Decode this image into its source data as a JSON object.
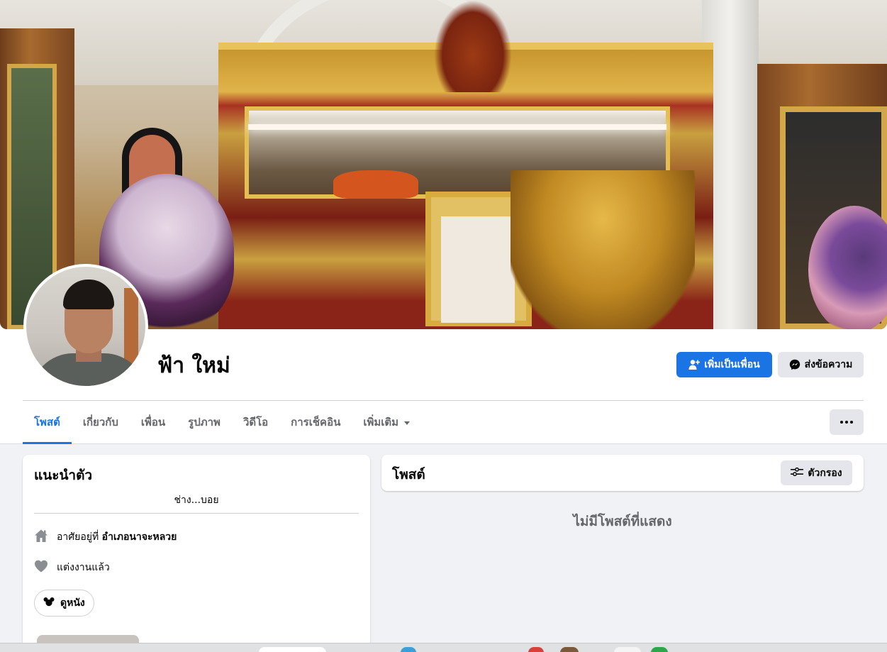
{
  "profile": {
    "name": "ฟ้า ใหม่",
    "add_friend_label": "เพิ่มเป็นเพื่อน",
    "message_label": "ส่งข้อความ"
  },
  "tabs": [
    {
      "label": "โพสต์",
      "active": true
    },
    {
      "label": "เกี่ยวกับ",
      "active": false
    },
    {
      "label": "เพื่อน",
      "active": false
    },
    {
      "label": "รูปภาพ",
      "active": false
    },
    {
      "label": "วิดีโอ",
      "active": false
    },
    {
      "label": "การเช็คอิน",
      "active": false
    },
    {
      "label": "เพิ่มเติม",
      "active": false,
      "dropdown": true
    }
  ],
  "intro": {
    "title": "แนะนำตัว",
    "bio": "ช่าง...บอย",
    "lives_prefix": "อาศัยอยู่ที่",
    "lives_place": "อำเภอนาจะหลวย",
    "relationship": "แต่งงานแล้ว",
    "hobby": "ดูหนัง"
  },
  "posts": {
    "title": "โพสต์",
    "filter_label": "ตัวกรอง",
    "empty_text": "ไม่มีโพสต์ที่แสดง"
  },
  "colors": {
    "accent": "#1b74e4",
    "page_bg": "#f0f2f5",
    "secondary_button": "#e4e6eb",
    "muted_text": "#65676b"
  },
  "icons": {
    "add_friend": "add-friend-icon",
    "messenger": "messenger-icon",
    "more": "more-dots-icon",
    "filter": "filter-sliders-icon",
    "home": "home-icon",
    "heart": "heart-icon",
    "hobby": "mickey-icon"
  }
}
